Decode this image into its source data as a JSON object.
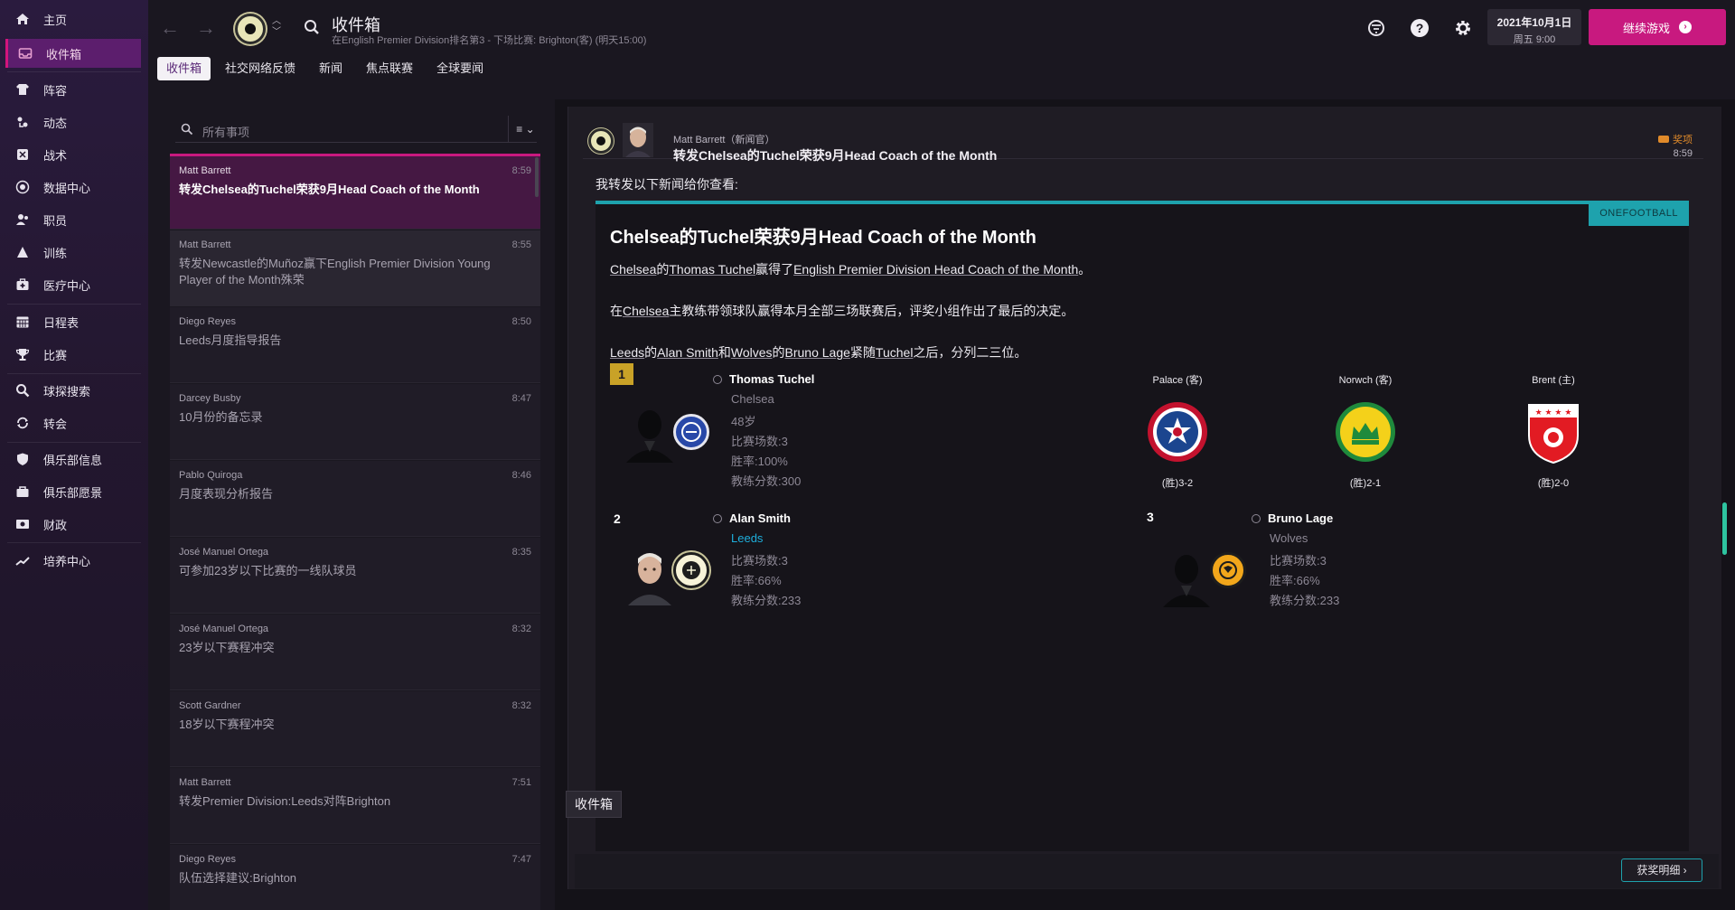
{
  "sidebar": {
    "items": [
      {
        "label": "主页",
        "icon": "home-icon"
      },
      {
        "label": "收件箱",
        "icon": "inbox-icon",
        "active": true
      },
      {
        "label": "阵容",
        "icon": "squad-icon"
      },
      {
        "label": "动态",
        "icon": "dynamics-icon"
      },
      {
        "label": "战术",
        "icon": "tactics-icon"
      },
      {
        "label": "数据中心",
        "icon": "data-hub-icon"
      },
      {
        "label": "职员",
        "icon": "staff-icon"
      },
      {
        "label": "训练",
        "icon": "training-icon"
      },
      {
        "label": "医疗中心",
        "icon": "medical-icon"
      },
      {
        "label": "日程表",
        "icon": "calendar-icon"
      },
      {
        "label": "比赛",
        "icon": "trophy-icon"
      },
      {
        "label": "球探搜索",
        "icon": "scouting-icon"
      },
      {
        "label": "转会",
        "icon": "transfers-icon"
      },
      {
        "label": "俱乐部信息",
        "icon": "club-info-icon"
      },
      {
        "label": "俱乐部愿景",
        "icon": "club-vision-icon"
      },
      {
        "label": "财政",
        "icon": "finances-icon"
      },
      {
        "label": "培养中心",
        "icon": "development-icon"
      }
    ]
  },
  "header": {
    "title": "收件箱",
    "subtitle": "在English Premier Division排名第3 - 下场比赛: Brighton(客) (明天15:00)",
    "tabs": [
      {
        "label": "收件箱",
        "active": true
      },
      {
        "label": "社交网络反馈"
      },
      {
        "label": "新闻"
      },
      {
        "label": "焦点联赛"
      },
      {
        "label": "全球要闻"
      }
    ],
    "date_line1": "2021年10月1日",
    "date_line2": "周五 9:00",
    "continue_label": "继续游戏"
  },
  "inbox": {
    "search_placeholder": "所有事项",
    "filter_label": "≡ ⌄",
    "messages": [
      {
        "sender": "Matt Barrett",
        "time": "8:59",
        "subject": "转发Chelsea的Tuchel荣获9月Head Coach of the Month",
        "state": "selected"
      },
      {
        "sender": "Matt Barrett",
        "time": "8:55",
        "subject": "转发Newcastle的Muñoz赢下English Premier Division Young Player of the Month殊荣",
        "state": "read"
      },
      {
        "sender": "Diego Reyes",
        "time": "8:50",
        "subject": "Leeds月度指导报告",
        "state": ""
      },
      {
        "sender": "Darcey Busby",
        "time": "8:47",
        "subject": "10月份的备忘录",
        "state": ""
      },
      {
        "sender": "Pablo Quiroga",
        "time": "8:46",
        "subject": "月度表现分析报告",
        "state": ""
      },
      {
        "sender": "José Manuel Ortega",
        "time": "8:35",
        "subject": "可参加23岁以下比赛的一线队球员",
        "state": ""
      },
      {
        "sender": "José Manuel Ortega",
        "time": "8:32",
        "subject": "23岁以下赛程冲突",
        "state": ""
      },
      {
        "sender": "Scott Gardner",
        "time": "8:32",
        "subject": "18岁以下赛程冲突",
        "state": ""
      },
      {
        "sender": "Matt Barrett",
        "time": "7:51",
        "subject": "转发Premier Division:Leeds对阵Brighton",
        "state": ""
      },
      {
        "sender": "Diego Reyes",
        "time": "7:47",
        "subject": "队伍选择建议:Brighton",
        "state": ""
      }
    ]
  },
  "message": {
    "from": "Matt Barrett（新闻官）",
    "subject": "转发Chelsea的Tuchel荣获9月Head Coach of the Month",
    "tag": "奖项",
    "time": "8:59",
    "intro": "我转发以下新闻给你查看:",
    "source": "ONEFOOTBALL",
    "article_title": "Chelsea的Tuchel荣获9月Head Coach of the Month",
    "para1": {
      "a": "Chelsea",
      "b": "的",
      "c": "Thomas Tuchel",
      "d": "赢得了",
      "e": "English Premier Division Head Coach of the Month",
      "f": "。"
    },
    "para2": {
      "a": "在",
      "b": "Chelsea",
      "c": "主教练带领球队赢得本月全部三场联赛后，评奖小组作出了最后的决定。"
    },
    "para3": {
      "a": "Leeds",
      "b": "的",
      "c": "Alan Smith",
      "d": "和",
      "e": "Wolves",
      "f": "的",
      "g": "Bruno Lage",
      "h": "紧随",
      "i": "Tuchel",
      "j": "之后，分列二三位。"
    },
    "coaches": [
      {
        "rank": "1",
        "name": "Thomas Tuchel",
        "club": "Chelsea",
        "age": "48岁",
        "matches": "比赛场数:3",
        "winrate": "胜率:100%",
        "points": "教练分数:300"
      },
      {
        "rank": "2",
        "name": "Alan Smith",
        "club": "Leeds",
        "matches": "比赛场数:3",
        "winrate": "胜率:66%",
        "points": "教练分数:233"
      },
      {
        "rank": "3",
        "name": "Bruno Lage",
        "club": "Wolves",
        "matches": "比赛场数:3",
        "winrate": "胜率:66%",
        "points": "教练分数:233"
      }
    ],
    "fixtures": [
      {
        "opponent": "Palace (客)",
        "result": "(胜)3-2"
      },
      {
        "opponent": "Norwch (客)",
        "result": "(胜)2-1"
      },
      {
        "opponent": "Brent (主)",
        "result": "(胜)2-0"
      }
    ]
  },
  "tooltip": "收件箱",
  "award_details_label": "获奖明细 ›",
  "colors": {
    "accent": "#c8197f",
    "teal": "#1ea2ad",
    "gold": "#c9a227",
    "link": "#1eaedb"
  }
}
